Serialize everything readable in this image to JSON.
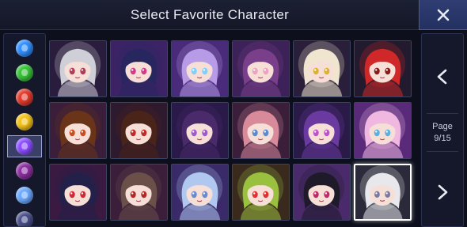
{
  "header": {
    "title": "Select Favorite Character"
  },
  "close_button": {
    "label": "X",
    "icon": "close-icon"
  },
  "sidebar": {
    "items": [
      {
        "name": "blue-gem",
        "color": "#2f8dff",
        "selected": false
      },
      {
        "name": "green-gem",
        "color": "#39c23a",
        "selected": false
      },
      {
        "name": "red-gem",
        "color": "#e23a2c",
        "selected": false
      },
      {
        "name": "yellow-gem",
        "color": "#f2c21a",
        "selected": false
      },
      {
        "name": "purple-gem",
        "color": "#8a4cff",
        "selected": true
      },
      {
        "name": "magenta-gem",
        "color": "#8b2fa0",
        "selected": false
      },
      {
        "name": "light-blue-gem",
        "color": "#6aa8ff",
        "selected": false
      },
      {
        "name": "dark-gem",
        "color": "#4a4f8a",
        "selected": false
      }
    ]
  },
  "pager": {
    "page_label": "Page",
    "page_value": "9/15",
    "prev_icon": "chevron-left-icon",
    "next_icon": "chevron-right-icon"
  },
  "characters": [
    {
      "name": "character-1",
      "hair": "#cfcfd8",
      "bg": "#2a1c3d",
      "eye": "#b23a5a",
      "selected": false
    },
    {
      "name": "character-2",
      "hair": "#28265e",
      "bg": "#3b2366",
      "eye": "#d23a8a",
      "selected": false
    },
    {
      "name": "character-3",
      "hair": "#b79be6",
      "bg": "#4a2a7a",
      "eye": "#7fd0ff",
      "selected": false
    },
    {
      "name": "character-4",
      "hair": "#7a3f8a",
      "bg": "#3d2259",
      "eye": "#f0a0c0",
      "selected": false
    },
    {
      "name": "character-5",
      "hair": "#f0e6d0",
      "bg": "#2a1f3a",
      "eye": "#e0b030",
      "selected": false
    },
    {
      "name": "character-6",
      "hair": "#d02828",
      "bg": "#221a2e",
      "eye": "#8a1a1a",
      "selected": false
    },
    {
      "name": "character-7",
      "hair": "#6a3418",
      "bg": "#3a1e3a",
      "eye": "#d04a20",
      "selected": false
    },
    {
      "name": "character-8",
      "hair": "#4a2418",
      "bg": "#2e1a2e",
      "eye": "#c02a2a",
      "selected": false
    },
    {
      "name": "character-9",
      "hair": "#4a2a6a",
      "bg": "#2a1a4a",
      "eye": "#a05ad0",
      "selected": false
    },
    {
      "name": "character-10",
      "hair": "#d88a9a",
      "bg": "#3a1e3a",
      "eye": "#5a8ad0",
      "selected": false
    },
    {
      "name": "character-11",
      "hair": "#6a3aa0",
      "bg": "#2a1a48",
      "eye": "#c050d0",
      "selected": false
    },
    {
      "name": "character-12",
      "hair": "#f0b8e0",
      "bg": "#5a2a7a",
      "eye": "#5ab0e0",
      "selected": false
    },
    {
      "name": "character-13",
      "hair": "#23204a",
      "bg": "#3a1a40",
      "eye": "#d02a3a",
      "selected": false
    },
    {
      "name": "character-14",
      "hair": "#6a5048",
      "bg": "#3a1e3a",
      "eye": "#b02a2a",
      "selected": false
    },
    {
      "name": "character-15",
      "hair": "#b0c8f0",
      "bg": "#3a2a6a",
      "eye": "#6a8ad0",
      "selected": false
    },
    {
      "name": "character-16",
      "hair": "#9ac040",
      "bg": "#3a2a1e",
      "eye": "#e03030",
      "selected": false
    },
    {
      "name": "character-17",
      "hair": "#1e1a2a",
      "bg": "#4a2a6a",
      "eye": "#c02a6a",
      "selected": false
    },
    {
      "name": "character-18",
      "hair": "#e8e8ec",
      "bg": "#2a2a3a",
      "eye": "#7a7aa0",
      "selected": true
    }
  ]
}
